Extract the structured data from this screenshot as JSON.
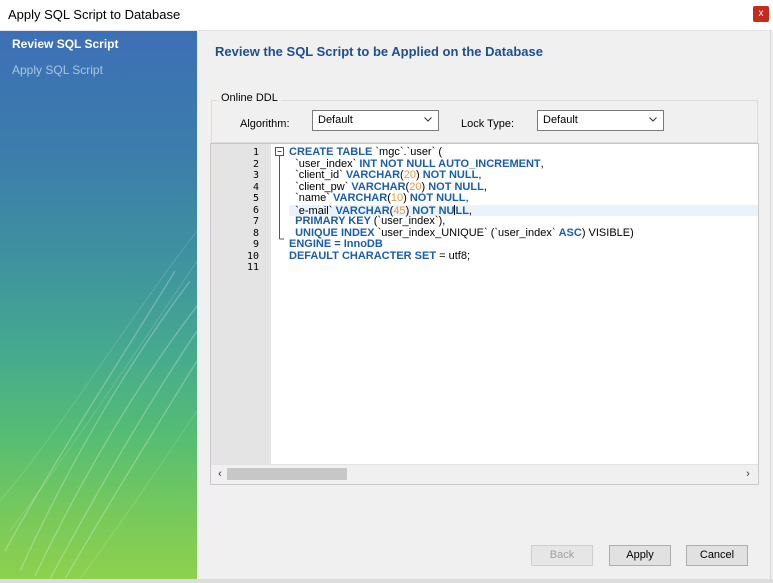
{
  "window": {
    "title": "Apply SQL Script to Database",
    "close_glyph": "x"
  },
  "sidebar": {
    "items": [
      {
        "label": "Review SQL Script",
        "active": true
      },
      {
        "label": "Apply SQL Script",
        "active": false
      }
    ]
  },
  "main": {
    "heading": "Review the SQL Script to be Applied on the Database",
    "online_ddl": {
      "legend": "Online DDL",
      "algorithm_label": "Algorithm:",
      "algorithm_value": "Default",
      "lock_type_label": "Lock Type:",
      "lock_type_value": "Default"
    },
    "editor": {
      "line_numbers": [
        "1",
        "2",
        "3",
        "4",
        "5",
        "6",
        "7",
        "8",
        "9",
        "10",
        "11"
      ],
      "lines": [
        [
          {
            "t": "CREATE TABLE ",
            "c": "kw"
          },
          {
            "t": "`mgc`.`user`",
            "c": "str"
          },
          {
            "t": " (",
            "c": "plain"
          }
        ],
        [
          {
            "t": "  `user_index` ",
            "c": "str"
          },
          {
            "t": "INT NOT NULL AUTO_INCREMENT",
            "c": "kw"
          },
          {
            "t": ",",
            "c": "plain"
          }
        ],
        [
          {
            "t": "  `client_id` ",
            "c": "str"
          },
          {
            "t": "VARCHAR",
            "c": "kw"
          },
          {
            "t": "(",
            "c": "plain"
          },
          {
            "t": "20",
            "c": "num"
          },
          {
            "t": ") ",
            "c": "plain"
          },
          {
            "t": "NOT NULL",
            "c": "kw"
          },
          {
            "t": ",",
            "c": "plain"
          }
        ],
        [
          {
            "t": "  `client_pw` ",
            "c": "str"
          },
          {
            "t": "VARCHAR",
            "c": "kw"
          },
          {
            "t": "(",
            "c": "plain"
          },
          {
            "t": "20",
            "c": "num"
          },
          {
            "t": ") ",
            "c": "plain"
          },
          {
            "t": "NOT NULL",
            "c": "kw"
          },
          {
            "t": ",",
            "c": "plain"
          }
        ],
        [
          {
            "t": "  `name` ",
            "c": "str"
          },
          {
            "t": "VARCHAR",
            "c": "kw"
          },
          {
            "t": "(",
            "c": "plain"
          },
          {
            "t": "10",
            "c": "num"
          },
          {
            "t": ") ",
            "c": "plain"
          },
          {
            "t": "NOT NULL",
            "c": "kw"
          },
          {
            "t": ",",
            "c": "plain"
          }
        ],
        [
          {
            "t": "  `e-mail` ",
            "c": "str"
          },
          {
            "t": "VARCHAR",
            "c": "kw"
          },
          {
            "t": "(",
            "c": "plain"
          },
          {
            "t": "45",
            "c": "num"
          },
          {
            "t": ") ",
            "c": "plain"
          },
          {
            "t": "NOT NU",
            "c": "kw"
          },
          {
            "t": "|",
            "c": "caret"
          },
          {
            "t": "LL",
            "c": "kw"
          },
          {
            "t": ",",
            "c": "plain"
          }
        ],
        [
          {
            "t": "  PRIMARY KEY ",
            "c": "kw"
          },
          {
            "t": "(`user_index`)",
            "c": "str"
          },
          {
            "t": ",",
            "c": "plain"
          }
        ],
        [
          {
            "t": "  UNIQUE INDEX ",
            "c": "kw"
          },
          {
            "t": "`user_index_UNIQUE` (`user_index` ",
            "c": "str"
          },
          {
            "t": "ASC",
            "c": "kw"
          },
          {
            "t": ") VISIBLE)",
            "c": "plain"
          }
        ],
        [
          {
            "t": "ENGINE = InnoDB",
            "c": "kw"
          }
        ],
        [
          {
            "t": "DEFAULT CHARACTER SET ",
            "c": "kw"
          },
          {
            "t": "= utf8;",
            "c": "plain"
          }
        ],
        []
      ]
    },
    "buttons": {
      "back": "Back",
      "apply": "Apply",
      "cancel": "Cancel"
    }
  },
  "colors": {
    "heading": "#1e4f8f",
    "keyword": "#1a5ea8",
    "number": "#e09a4a",
    "close": "#c42b1c"
  }
}
